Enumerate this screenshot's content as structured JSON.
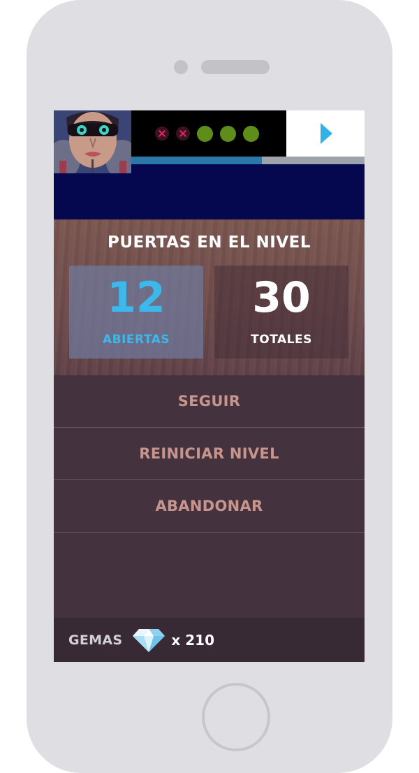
{
  "hud": {
    "attempts": [
      "fail",
      "fail",
      "ok",
      "ok",
      "ok"
    ],
    "level_progress": 0.56,
    "play_icon": "play-icon"
  },
  "doors": {
    "title": "PUERTAS EN EL NIVEL",
    "open_value": "12",
    "open_label": "ABIERTAS",
    "total_value": "30",
    "total_label": "TOTALES"
  },
  "menu": {
    "continue_label": "SEGUIR",
    "restart_label": "REINICIAR NIVEL",
    "quit_label": "ABANDONAR"
  },
  "footer": {
    "gems_label": "GEMAS",
    "gem_icon": "diamond-icon",
    "gems_count": "x 210"
  },
  "colors": {
    "accent_blue": "#3cb8ea",
    "menu_text": "#c7958b",
    "success_dot": "#5e8d1a",
    "fail_mark": "#e0245e",
    "ad_background": "#05084f"
  }
}
